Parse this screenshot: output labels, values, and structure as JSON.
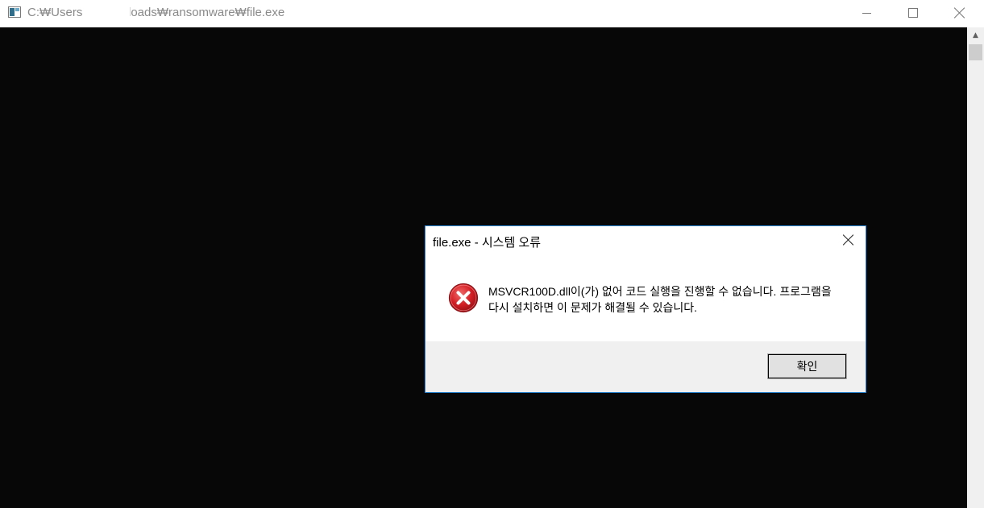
{
  "console_window": {
    "title": "C:₩Users₩        Downloads₩ransomware₩file.exe",
    "icon": "console-app-icon",
    "buttons": {
      "minimize": "minimize-icon",
      "maximize": "maximize-icon",
      "close": "close-icon"
    },
    "background_color": "#070707"
  },
  "dialog": {
    "title": "file.exe - 시스템 오류",
    "icon": "error-icon",
    "message": "MSVCR100D.dll이(가) 없어 코드 실행을 진행할 수 없습니다. 프로그램을 다시 설치하면 이 문제가 해결될 수 있습니다.",
    "ok_label": "확인",
    "border_color": "#2a86d1",
    "error_color": "#d31f25"
  }
}
